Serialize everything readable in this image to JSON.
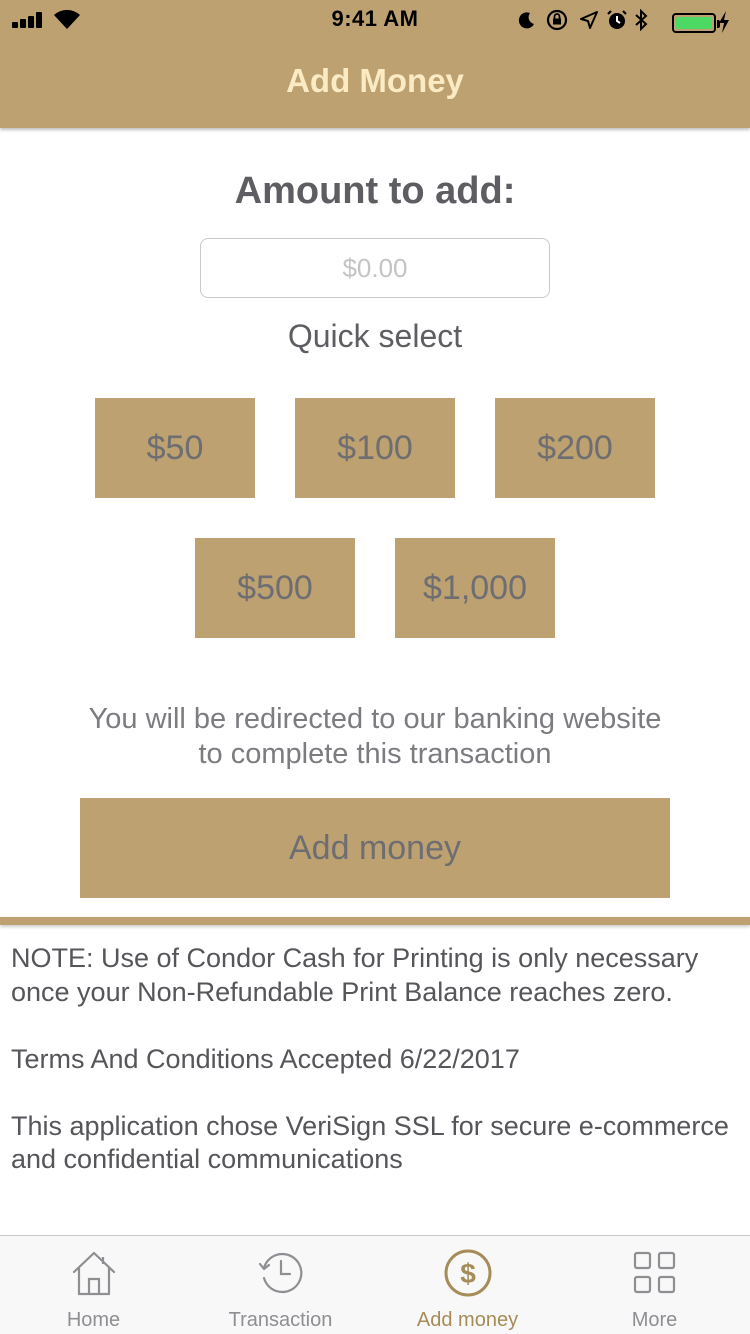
{
  "status_bar": {
    "time": "9:41 AM"
  },
  "header": {
    "title": "Add Money"
  },
  "amount": {
    "title": "Amount to add:",
    "placeholder": "$0.00",
    "value": ""
  },
  "quick_select": {
    "label": "Quick select",
    "options": [
      "$50",
      "$100",
      "$200",
      "$500",
      "$1,000"
    ]
  },
  "redirect_notice": {
    "line1": "You will be redirected to our banking website",
    "line2": "to complete this transaction"
  },
  "add_button": {
    "label": "Add money"
  },
  "notes": {
    "note": "NOTE: Use of Condor Cash for Printing is only necessary once your Non-Refundable Print Balance reaches zero.",
    "terms": "Terms And Conditions Accepted 6/22/2017",
    "security": "This application chose VeriSign SSL for secure e-commerce and confidential communications"
  },
  "tab_bar": {
    "items": [
      {
        "label": "Home",
        "icon": "home-icon"
      },
      {
        "label": "Transaction",
        "icon": "history-icon"
      },
      {
        "label": "Add money",
        "icon": "dollar-circle-icon",
        "active": true
      },
      {
        "label": "More",
        "icon": "grid-icon"
      }
    ]
  },
  "colors": {
    "accent": "#bda170",
    "header_title": "#fbebc4",
    "battery": "#4cd964",
    "active_tab": "#a58c58",
    "inactive_tab": "#8e8e93"
  }
}
